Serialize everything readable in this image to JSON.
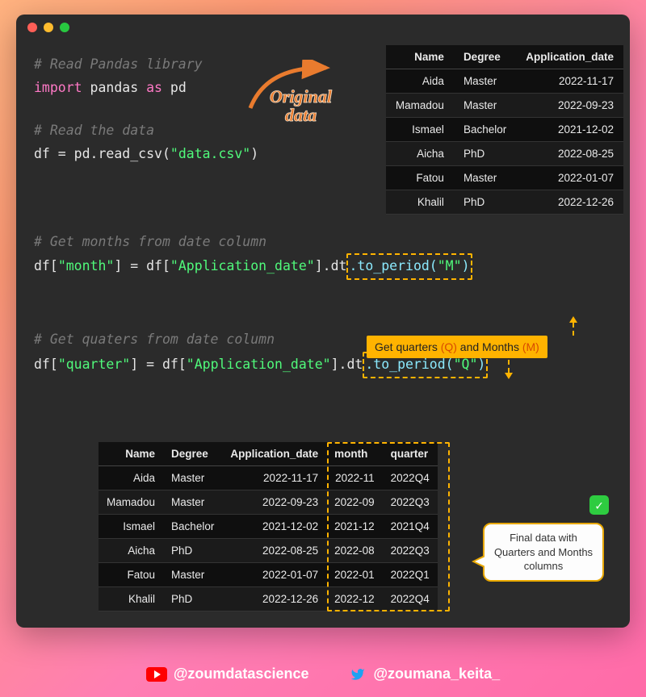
{
  "code": {
    "c1": "# Read Pandas library",
    "import": "import",
    "pandas": "pandas",
    "as": "as",
    "pd": "pd",
    "c2": "# Read the data",
    "line_read_a": "df = pd.read_csv(",
    "line_read_str": "\"data.csv\"",
    "line_read_b": ")",
    "c3": "# Get months from date column",
    "month_a": "df[",
    "month_str1": "\"month\"",
    "month_b": "] = df[",
    "month_str2": "\"Application_date\"",
    "month_c": "].dt",
    "month_call_a": ".to_period(",
    "month_call_str": "\"M\"",
    "month_call_b": ")",
    "c4": "# Get quaters from date column",
    "q_a": "df[",
    "q_str1": "\"quarter\"",
    "q_b": "] = df[",
    "q_str2": "\"Application_date\"",
    "q_c": "].dt",
    "q_call_a": ".to_period(",
    "q_call_str": "\"Q\"",
    "q_call_b": ")"
  },
  "labels": {
    "original_l1": "Original",
    "original_l2": "data",
    "callout_pre": "Get quarters ",
    "callout_q": "(Q)",
    "callout_mid": " and Months ",
    "callout_m": "(M)",
    "bubble": "Final data with Quarters and Months columns",
    "check": "✓"
  },
  "table_orig": {
    "headers": [
      "Name",
      "Degree",
      "Application_date"
    ],
    "rows": [
      [
        "Aida",
        "Master",
        "2022-11-17"
      ],
      [
        "Mamadou",
        "Master",
        "2022-09-23"
      ],
      [
        "Ismael",
        "Bachelor",
        "2021-12-02"
      ],
      [
        "Aicha",
        "PhD",
        "2022-08-25"
      ],
      [
        "Fatou",
        "Master",
        "2022-01-07"
      ],
      [
        "Khalil",
        "PhD",
        "2022-12-26"
      ]
    ]
  },
  "table_final": {
    "headers": [
      "Name",
      "Degree",
      "Application_date",
      "month",
      "quarter"
    ],
    "rows": [
      [
        "Aida",
        "Master",
        "2022-11-17",
        "2022-11",
        "2022Q4"
      ],
      [
        "Mamadou",
        "Master",
        "2022-09-23",
        "2022-09",
        "2022Q3"
      ],
      [
        "Ismael",
        "Bachelor",
        "2021-12-02",
        "2021-12",
        "2021Q4"
      ],
      [
        "Aicha",
        "PhD",
        "2022-08-25",
        "2022-08",
        "2022Q3"
      ],
      [
        "Fatou",
        "Master",
        "2022-01-07",
        "2022-01",
        "2022Q1"
      ],
      [
        "Khalil",
        "PhD",
        "2022-12-26",
        "2022-12",
        "2022Q4"
      ]
    ]
  },
  "footer": {
    "youtube": "@zoumdatascience",
    "twitter": "@zoumana_keita_"
  }
}
